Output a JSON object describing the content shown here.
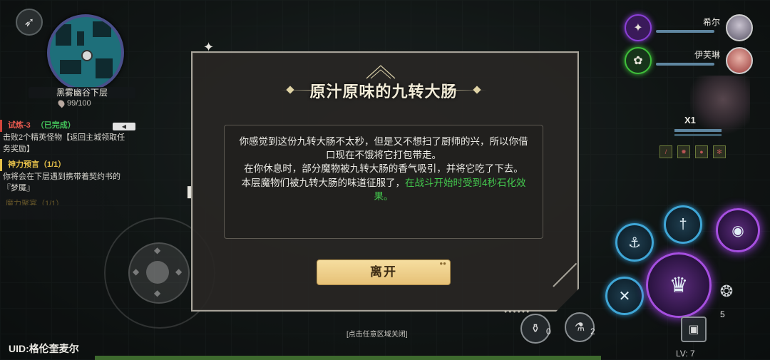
{
  "hud": {
    "area_name": "黑雾幽谷下层",
    "hp": "99/100",
    "uid": "UID:格伦奎麦尔",
    "level": "LV: 7"
  },
  "quests": [
    {
      "title": "试炼-3",
      "status": "（已完成）",
      "desc": "击败2个精英怪物【返回主城领取任务奖励】"
    },
    {
      "title": "神力预言",
      "count": "（1/1）",
      "desc": "你将会在下层遇到携带着契约书的『梦魇』"
    },
    {
      "title_faded": "魔力聚宴（1/1）"
    }
  ],
  "party": [
    {
      "name": "希尔",
      "ring_color": "#8a3fd6"
    },
    {
      "name": "伊芙琳",
      "ring_color": "#3fbf3a"
    }
  ],
  "hero": {
    "multiplier": "X1"
  },
  "items": [
    {
      "icon": "potion-icon",
      "count": "0"
    },
    {
      "icon": "flask-icon",
      "count": "2"
    }
  ],
  "skill_counts": {
    "dash": "5"
  },
  "dialog": {
    "title": "原汁原味的九转大肠",
    "paragraphs": [
      "你感觉到这份九转大肠不太秒，但是又不想扫了厨师的兴，所以你借口现在不饿将它打包带走。",
      "在你休息时，部分魔物被九转大肠的香气吸引，并将它吃了下去。"
    ],
    "result_prefix": "本层魔物们被九转大肠的味道征服了，",
    "result_effect": "在战斗开始时受到4秒石化效果。",
    "leave_button": "离开",
    "close_hint": "[点击任意区域关闭]"
  }
}
